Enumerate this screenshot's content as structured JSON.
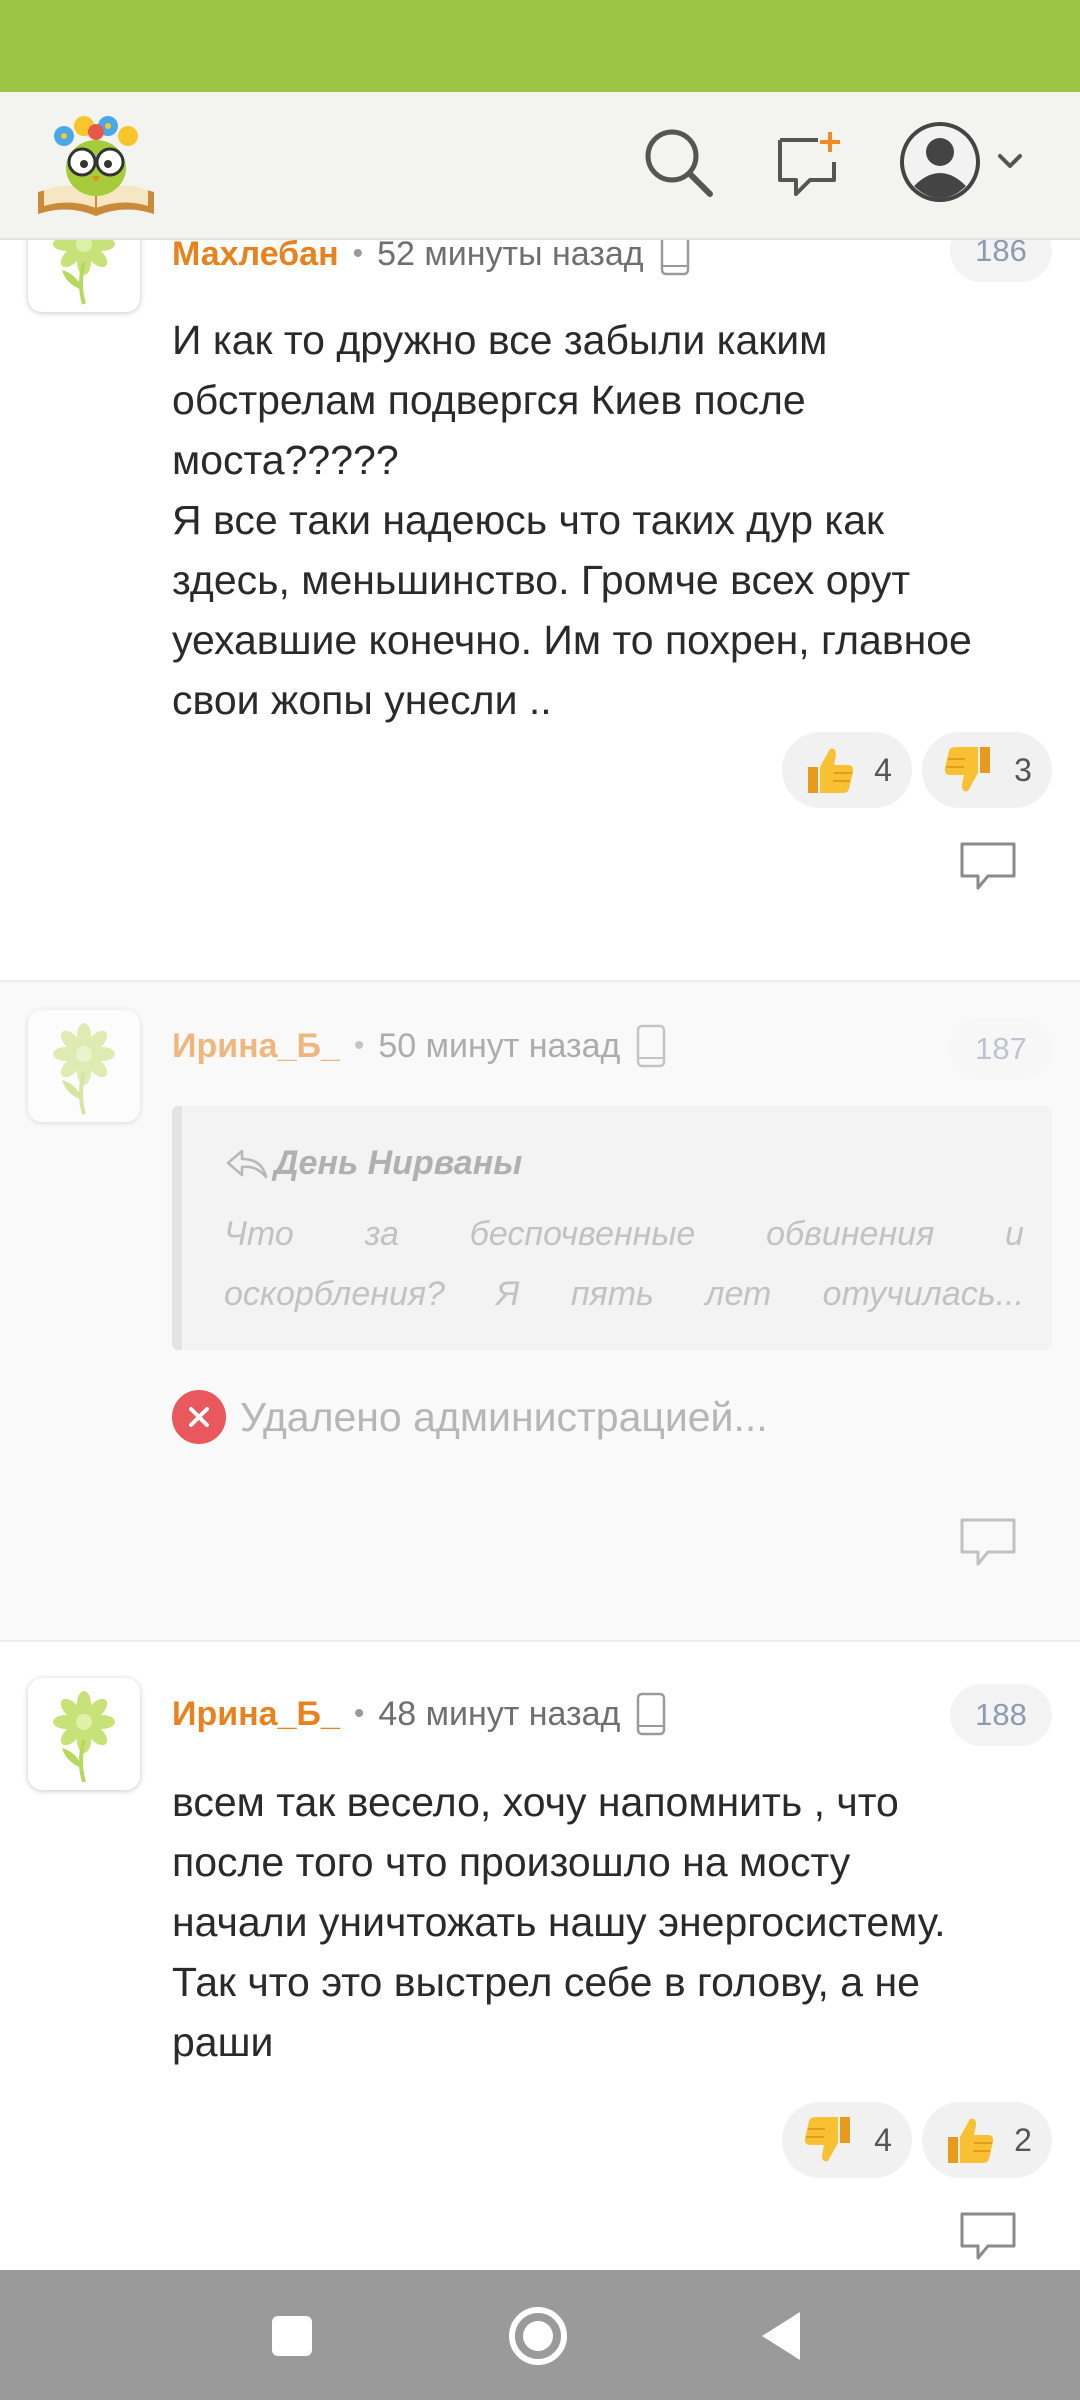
{
  "header": {
    "logo_icon": "owl-on-book-logo",
    "search_icon": "search-icon",
    "new_post_icon": "new-message-icon",
    "profile_icon": "user-avatar-icon",
    "menu_icon": "chevron-down-icon"
  },
  "comments": [
    {
      "author": "Махлебан",
      "time": "52 минуты назад",
      "number": "186",
      "text_lines": [
        "И как то дружно все забыли каким",
        "обстрелам подвергся Киев после",
        "моста?????",
        "Я все таки надеюсь что таких дур как",
        "здесь, меньшинство. Громче всех орут",
        "уехавшие конечно. Им то похрен, главное",
        "свои жопы унесли .."
      ],
      "reactions": [
        {
          "type": "thumbs-up",
          "count": "4"
        },
        {
          "type": "thumbs-down",
          "count": "3"
        }
      ]
    },
    {
      "author": "Ирина_Б_",
      "time": "50 минут назад",
      "number": "187",
      "quote": {
        "author": "День Нирваны",
        "line1": [
          "Что",
          "за",
          "беспочвенные",
          "обвинения",
          "и"
        ],
        "line2": [
          "оскорбления?",
          "Я",
          "пять",
          "лет",
          "отучилась..."
        ]
      },
      "deleted_text": "Удалено администрацией..."
    },
    {
      "author": "Ирина_Б_",
      "time": "48 минут назад",
      "number": "188",
      "text_lines": [
        "всем так весело, хочу напомнить , что",
        "после того что произошло на мосту",
        "начали уничтожать нашу энергосистему.",
        "Так что это выстрел себе в голову, а не",
        "раши"
      ],
      "reactions": [
        {
          "type": "thumbs-down",
          "count": "4"
        },
        {
          "type": "thumbs-up",
          "count": "2"
        }
      ]
    }
  ],
  "colors": {
    "status_bar": "#9dc444",
    "author": "#e8821f",
    "reaction_emoji": "#f5b52a",
    "deleted_badge": "#e8585c"
  },
  "nav": {
    "recents_icon": "square-icon",
    "home_icon": "circle-icon",
    "back_icon": "triangle-back-icon"
  }
}
